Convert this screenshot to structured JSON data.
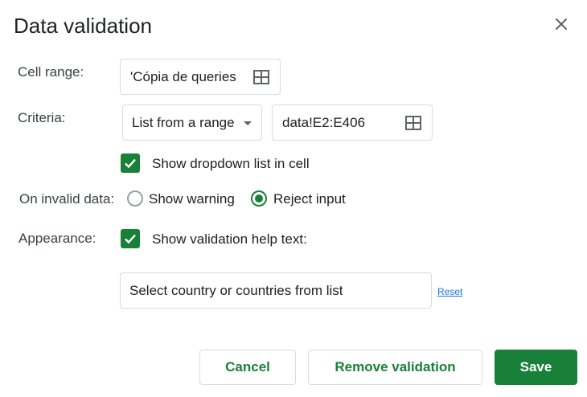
{
  "dialog": {
    "title": "Data validation",
    "close_icon": "close-icon"
  },
  "cell_range": {
    "label": "Cell range:",
    "value": "'Cópia de queries",
    "icon": "grid-select-icon"
  },
  "criteria": {
    "label": "Criteria:",
    "type_selected": "List from a range",
    "range_value": "data!E2:E406",
    "icon": "grid-select-icon"
  },
  "dropdown_option": {
    "checked": true,
    "label": "Show dropdown list in cell"
  },
  "invalid_data": {
    "label": "On invalid data:",
    "options": [
      {
        "label": "Show warning",
        "selected": false
      },
      {
        "label": "Reject input",
        "selected": true
      }
    ]
  },
  "appearance": {
    "label": "Appearance:",
    "checked": true,
    "checkbox_label": "Show validation help text:",
    "help_text_value": "Select country or countries from list",
    "reset_label": "Reset"
  },
  "buttons": {
    "cancel": "Cancel",
    "remove": "Remove validation",
    "save": "Save"
  },
  "colors": {
    "accent": "#188038",
    "link": "#1a73e8",
    "border": "#dadce0"
  }
}
